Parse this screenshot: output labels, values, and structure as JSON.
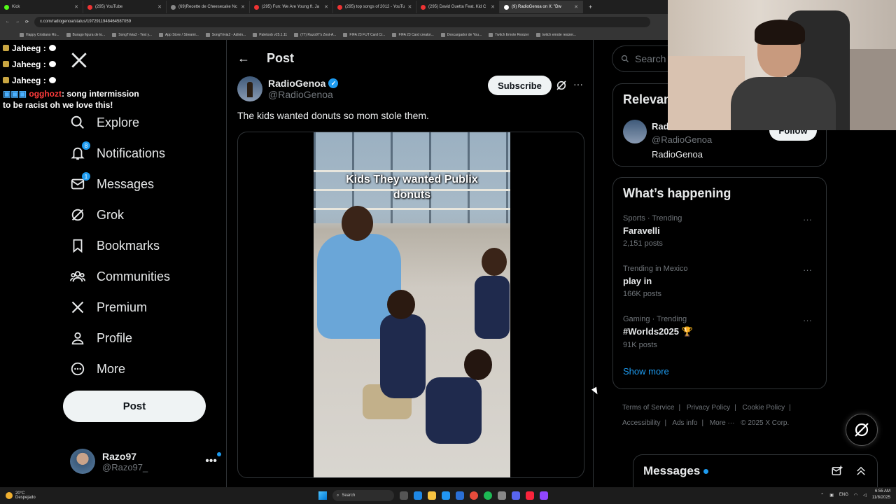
{
  "browser": {
    "tabs": [
      {
        "title": "Kick",
        "active": false
      },
      {
        "title": "(295) YouTube",
        "active": false
      },
      {
        "title": "(69)Recette de Cheesecake Nc",
        "active": false
      },
      {
        "title": "(295) Fun: We Are Young ft. Ja",
        "active": false
      },
      {
        "title": "(295) top songs of 2012 - YouTu",
        "active": false
      },
      {
        "title": "(295) David Guetta Feat. Kid C",
        "active": false
      },
      {
        "title": "(9) RadioGenoa on X: \"Dw",
        "active": true
      }
    ],
    "new_tab": "+",
    "url": "x.com/radiogenoa/status/1972911948464587059",
    "bookmarks": [
      "Happy Cristiano Ro...",
      "Burago figura de to...",
      "SongTrivia2 - Test y...",
      "App Store / Streami...",
      "SongTrivia2 - Adivin...",
      "Paletoob v25.1.11",
      "(77) Razo97's Zest-A...",
      "FIFA 23 FUT Card Cr...",
      "FIFA 23 Card creator...",
      "Descargador de You...",
      "Twitch Emote Resizer",
      "twitch emote resizer..."
    ]
  },
  "chat": {
    "lines": [
      {
        "name": "Jaheeg :"
      },
      {
        "name": "Jaheeg :"
      },
      {
        "name": "Jaheeg :"
      }
    ],
    "message_user": "ogghozt",
    "message_text": ": song intermission",
    "message_line2": "to be racist oh we love this!"
  },
  "nav": {
    "items": [
      {
        "label": "Explore",
        "icon": "search-icon"
      },
      {
        "label": "Notifications",
        "icon": "bell-icon",
        "badge": "8"
      },
      {
        "label": "Messages",
        "icon": "mail-icon",
        "badge": "1"
      },
      {
        "label": "Grok",
        "icon": "grok-icon"
      },
      {
        "label": "Bookmarks",
        "icon": "bookmark-icon"
      },
      {
        "label": "Communities",
        "icon": "communities-icon"
      },
      {
        "label": "Premium",
        "icon": "x-logo-icon"
      },
      {
        "label": "Profile",
        "icon": "person-icon"
      },
      {
        "label": "More",
        "icon": "more-circle-icon"
      }
    ],
    "post_button": "Post",
    "account": {
      "name": "Razo97",
      "handle": "@Razo97_",
      "more": "•••"
    }
  },
  "post": {
    "header": "Post",
    "author_name": "RadioGenoa",
    "author_handle": "@RadioGenoa",
    "subscribe": "Subscribe",
    "more": "···",
    "text": "The kids wanted donuts so mom stole them.",
    "video_caption_line1": "Kids They wanted Publix",
    "video_caption_line2": "donuts"
  },
  "sidebar": {
    "search_placeholder": "Search",
    "relevant_title": "Relevan",
    "relevant_name": "Rad",
    "relevant_handle": "@RadioGenoa",
    "relevant_bio": "RadioGenoa",
    "follow": "Follow",
    "happening_title": "What’s happening",
    "trends": [
      {
        "meta": "Sports · Trending",
        "topic": "Faravelli",
        "count": "2,151 posts"
      },
      {
        "meta": "Trending in Mexico",
        "topic": "play in",
        "count": "166K posts"
      },
      {
        "meta": "Gaming · Trending",
        "topic": "#Worlds2025 🏆",
        "count": "91K posts"
      }
    ],
    "trend_more": "···",
    "show_more": "Show more",
    "footer": {
      "line1": [
        "Terms of Service",
        "|",
        "Privacy Policy",
        "|",
        "Cookie Policy",
        "|"
      ],
      "line2": [
        "Accessibility",
        "|",
        "Ads info",
        "|",
        "More ···",
        "© 2025 X Corp."
      ]
    },
    "messages_dock": "Messages"
  },
  "taskbar": {
    "temp": "20°C",
    "weather": "Despejado",
    "search": "Search",
    "lang": "ENG",
    "time": "6:55 AM",
    "date": "11/8/2025"
  },
  "colors": {
    "accent": "#1d9bf0",
    "bg": "#000000",
    "text": "#e7e9ea",
    "muted": "#71767b",
    "border": "#2f3336"
  }
}
